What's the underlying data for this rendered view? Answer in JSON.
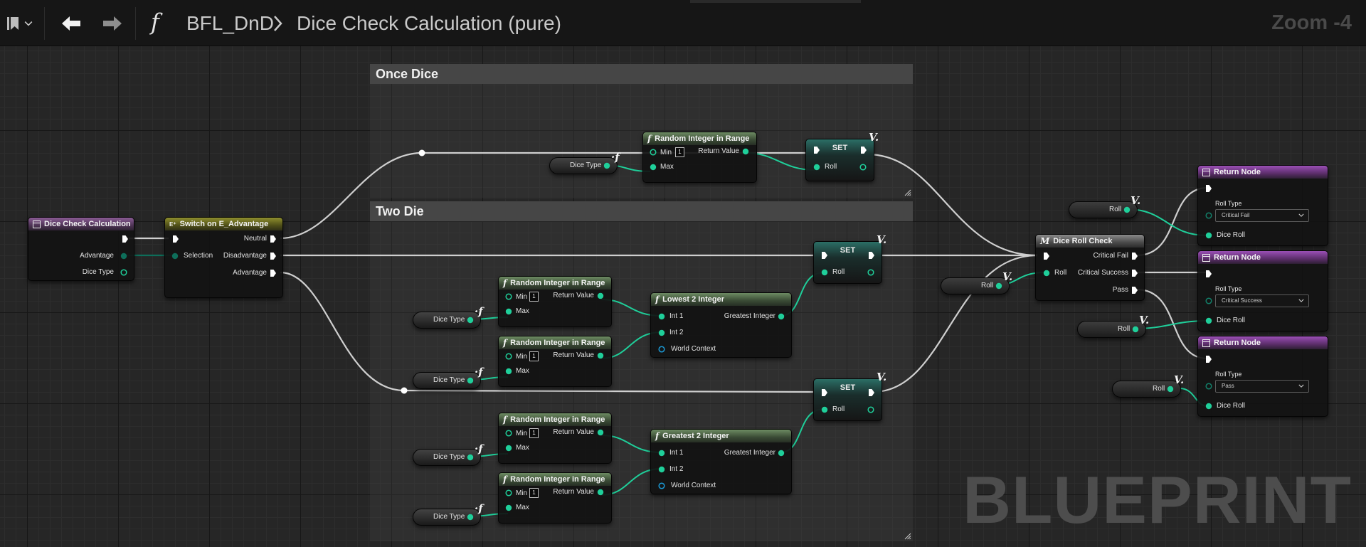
{
  "toolbar": {
    "breadcrumb_asset": "BFL_DnD",
    "breadcrumb_function": "Dice Check Calculation (pure)",
    "zoom": "Zoom -4",
    "function_glyph": "f"
  },
  "icons": [
    "bookmark-icon",
    "chevron-down-icon",
    "back-arrow-icon",
    "forward-arrow-icon",
    "function-icon",
    "chevron-right-icon"
  ],
  "colors": {
    "exec_wire": "#cfcfcf",
    "int_wire": "#1fcf9a",
    "enum_pin": "#0e6e5a",
    "object_pin": "#1b9bd8"
  },
  "comments": {
    "once_dice": "Once Dice",
    "two_die": "Two Die"
  },
  "nodes": {
    "entry": {
      "title": "Dice Check Calculation",
      "pins": [
        "Advantage",
        "Dice Type"
      ]
    },
    "switch": {
      "title": "Switch on E_Advantage",
      "pins": [
        "Selection",
        "Neutral",
        "Disadvantage",
        "Advantage"
      ]
    },
    "random": {
      "title": "Random Integer in Range",
      "min": "Min",
      "max": "Max",
      "min_value": "1",
      "return": "Return Value"
    },
    "dice_type": "Dice Type",
    "set": {
      "title": "SET",
      "roll": "Roll"
    },
    "lowest": {
      "title": "Lowest 2 Integer"
    },
    "greatest": {
      "title": "Greatest 2 Integer"
    },
    "twoint": {
      "int1": "Int 1",
      "int2": "Int 2",
      "world": "World Context",
      "out": "Greatest Integer"
    },
    "dice_roll_check": {
      "title": "Dice Roll Check",
      "roll": "Roll",
      "outs": [
        "Critical Fail",
        "Critical Success",
        "Pass"
      ]
    },
    "return_node": {
      "title": "Return Node",
      "roll_type": "Roll Type",
      "dice_roll": "Dice Roll",
      "types": [
        "Critical Fail",
        "Critical Success",
        "Pass"
      ]
    },
    "roll_getter": "Roll"
  },
  "watermark": "BLUEPRINT"
}
